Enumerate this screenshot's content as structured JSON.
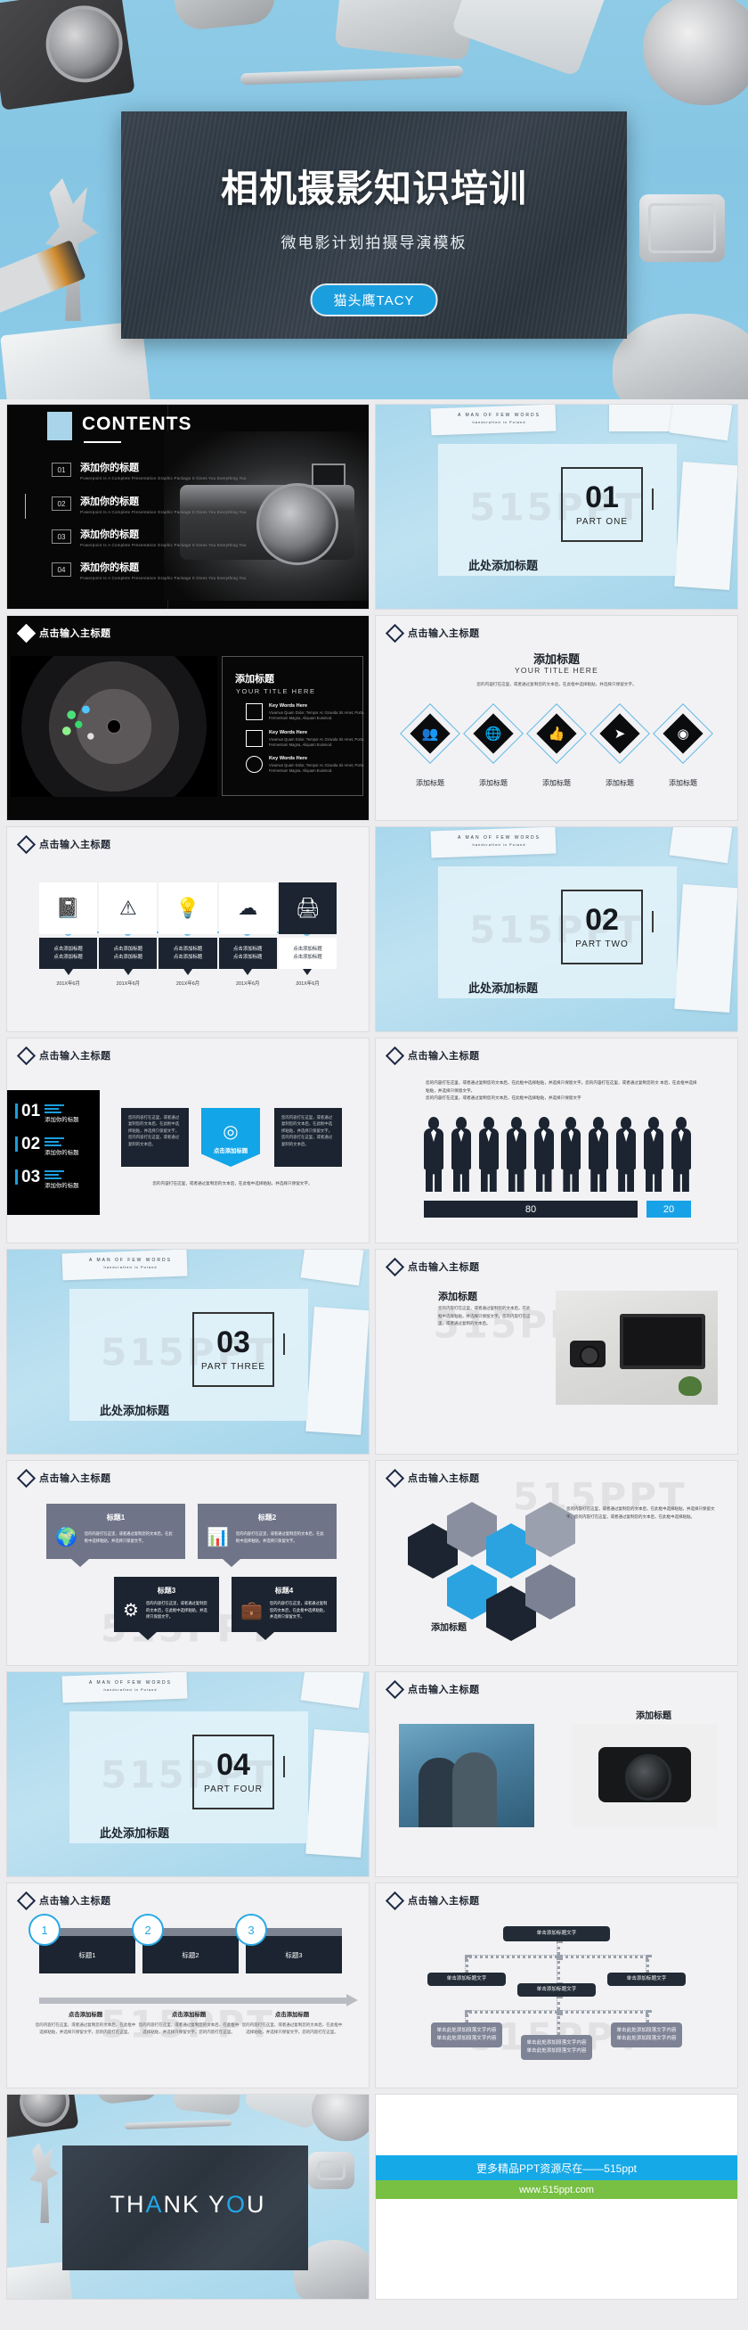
{
  "hero": {
    "title": "相机摄影知识培训",
    "subtitle": "微电影计划拍摄导演模板",
    "button": "猫头鹰TACY"
  },
  "common": {
    "section_header": "点击输入主标题",
    "watermark": "515PPT",
    "add_title": "添加标题",
    "your_title_here": "YOUR TITLE HERE",
    "click_add_title": "点击添加标题",
    "add_your_title": "添加你的标题",
    "lorem_cn": "您的内容打在这里，或者通过复制您的文本后，在此框中选择粘贴，并选择只保留文字。",
    "key_words": "Key Words Here",
    "key_body": "Vivamus Quam Dolor, Tempor Ac Gravida Sit Amet, Porta Fermentum Magna, Aliquam Euismod.",
    "mock_header": "A MAN OF FEW WORDS",
    "mock_sub": "handcrafted in Poland"
  },
  "slides": {
    "contents": {
      "title": "CONTENTS",
      "items": [
        {
          "num": "01",
          "heading": "添加你的标题",
          "desc": "Powerpoint Is A Complete Presentation Graphic Package It Gives You Everything You"
        },
        {
          "num": "02",
          "heading": "添加你的标题",
          "desc": "Powerpoint Is A Complete Presentation Graphic Package It Gives You Everything You"
        },
        {
          "num": "03",
          "heading": "添加你的标题",
          "desc": "Powerpoint Is A Complete Presentation Graphic Package It Gives You Everything You"
        },
        {
          "num": "04",
          "heading": "添加你的标题",
          "desc": "Powerpoint Is A Complete Presentation Graphic Package It Gives You Everything You"
        }
      ]
    },
    "parts": [
      {
        "label": "此处添加标题",
        "num": "01",
        "sub": "PART ONE"
      },
      {
        "label": "此处添加标题",
        "num": "02",
        "sub": "PART TWO"
      },
      {
        "label": "此处添加标题",
        "num": "03",
        "sub": "PART THREE"
      },
      {
        "label": "此处添加标题",
        "num": "04",
        "sub": "PART FOUR"
      }
    ],
    "aperture": {
      "header": "点击输入主标题",
      "panel_title": "添加标题",
      "panel_sub": "YOUR TITLE HERE",
      "keys": [
        {
          "icon": "user-badge-icon",
          "title": "Key Words Here",
          "body": "Vivamus Quam Dolor, Tempor Ac Gravida Sit Amet, Porta Fermentum Magna, Aliquam Euismod."
        },
        {
          "icon": "window-icon",
          "title": "Key Words Here",
          "body": "Vivamus Quam Dolor, Tempor Ac Gravida Sit Amet, Porta Fermentum Magna, Aliquam Euismod."
        },
        {
          "icon": "pie-chart-icon",
          "title": "Key Words Here",
          "body": "Vivamus Quam Dolor, Tempor Ac Gravida Sit Amet, Porta Fermentum Magna, Aliquam Euismod."
        }
      ]
    },
    "diamonds": {
      "header": "点击输入主标题",
      "title": "添加标题",
      "subtitle": "YOUR TITLE HERE",
      "desc": "您的内容打在这里，或者通过复制您的文本后，在此框中选择粘贴，并选择只保留文字。",
      "items": [
        {
          "glyph": "👥",
          "icon": "people-icon",
          "caption": "添加标题"
        },
        {
          "glyph": "🌐",
          "icon": "globe-icon",
          "caption": "添加标题"
        },
        {
          "glyph": "👍",
          "icon": "thumbs-up-icon",
          "caption": "添加标题"
        },
        {
          "glyph": "➤",
          "icon": "paper-plane-icon",
          "caption": "添加标题"
        },
        {
          "glyph": "◉",
          "icon": "eye-icon",
          "caption": "添加标题"
        }
      ]
    },
    "timeline_icons": {
      "header": "点击输入主标题",
      "items": [
        {
          "glyph": "📓",
          "icon": "notebook-icon",
          "line1": "点击添加标题",
          "line2": "点击添加标题",
          "date": "201X年6月"
        },
        {
          "glyph": "⚠",
          "icon": "warning-icon",
          "line1": "点击添加标题",
          "line2": "点击添加标题",
          "date": "201X年6月"
        },
        {
          "glyph": "💡",
          "icon": "lightbulb-icon",
          "line1": "点击添加标题",
          "line2": "点击添加标题",
          "date": "201X年6月"
        },
        {
          "glyph": "☁",
          "icon": "cloud-icon",
          "line1": "点击添加标题",
          "line2": "点击添加标题",
          "date": "201X年6月"
        },
        {
          "glyph": "🖨",
          "icon": "printer-icon",
          "line1": "点击添加标题",
          "line2": "点击添加标题",
          "date": "201X年6月"
        }
      ]
    },
    "numbered": {
      "header": "点击输入主标题",
      "list": [
        {
          "num": "01",
          "label": "添加你的标题"
        },
        {
          "num": "02",
          "label": "添加你的标题"
        },
        {
          "num": "03",
          "label": "添加你的标题"
        }
      ],
      "left_box": "您的内容打在这里，或者通过复制您的文本后，在此框中选择粘贴，并选择只保留文字。您的内容打在这里，或者通过复制的文本后。",
      "right_box": "您的内容打在这里，或者通过复制您的文本后，在此框中选择粘贴，并选择只保留文字。您的内容打在这里，或者通过复制的文本后。",
      "center_caption": "点击添加标题",
      "center_icon": "target-icon",
      "footer": "您的内容打在这里，或者通过复制您的文本后，在此框中选择粘贴，并选择只保留文字。"
    },
    "people": {
      "header": "点击输入主标题",
      "desc_line1": "您的内容打在这里，或者通过复制您的文本后，在此框中选择粘贴，并选择只保留文字。您的内容打在这里，或者通过复制您的文",
      "desc_line2": "本后，在此框中选择粘贴，并选择只保留文字。",
      "desc_line3": "您的内容打在这里，或者通过复制您的文本后，在此框中选择粘贴，并选择只保留文字"
    },
    "laptop": {
      "header": "点击输入主标题",
      "title": "添加标题",
      "body": "您的内容打在这里，或者通过复制您的文本后，在此框中选择粘贴，并选择只保留文字。您的内容打在这里，或者通过复制的文本后。"
    },
    "cards4": {
      "header": "点击输入主标题",
      "items": [
        {
          "title": "标题1",
          "glyph": "🌍",
          "icon": "globe-icon",
          "body": "您的内容打在这里，或者通过复制您的文本后，在此框中选择粘贴，并选择只保留文字。",
          "tone": "gray"
        },
        {
          "title": "标题2",
          "glyph": "📊",
          "icon": "bar-chart-icon",
          "body": "您的内容打在这里，或者通过复制您的文本后，在此框中选择粘贴，并选择只保留文字。",
          "tone": "gray"
        },
        {
          "title": "标题3",
          "glyph": "⚙",
          "icon": "gears-icon",
          "body": "您的内容打在这里，或者通过复制您的文本后，在此框中选择粘贴，并选择只保留文字。",
          "tone": "dark"
        },
        {
          "title": "标题4",
          "glyph": "💼",
          "icon": "briefcase-icon",
          "body": "您的内容打在这里，或者通过复制您的文本后，在此框中选择粘贴，并选择只保留文字。",
          "tone": "dark"
        }
      ]
    },
    "hexagons": {
      "header": "点击输入主标题",
      "caption": "添加标题",
      "body": "您的内容打在这里，或者通过复制您的文本后，在此框中选择粘贴，并选择只保留文字。您的内容打在这里，或者通过复制您的文本后，在此框中选择粘贴。"
    },
    "steps": {
      "header": "点击输入主标题",
      "items": [
        {
          "num": "1",
          "label": "标题1",
          "title": "点击添加标题",
          "body": "您的内容打在这里，或者通过复制您的文本后，在此框中选择粘贴，并选择只保留文字。您的内容打在这里。"
        },
        {
          "num": "2",
          "label": "标题2",
          "title": "点击添加标题",
          "body": "您的内容打在这里，或者通过复制您的文本后，在此框中选择粘贴，并选择只保留文字。您的内容打在这里。"
        },
        {
          "num": "3",
          "label": "标题3",
          "title": "点击添加标题",
          "body": "您的内容打在这里，或者通过复制您的文本后，在此框中选择粘贴，并选择只保留文字。您的内容打在这里。"
        }
      ]
    },
    "couple": {
      "header": "点击输入主标题",
      "title": "添加标题"
    },
    "orgchart": {
      "header": "点击输入主标题",
      "root": "单击添加标题文字",
      "level2": [
        "单击添加标题文字",
        "单击添加标题文字",
        "单击添加标题文字"
      ],
      "level3": [
        "单击此处添加段落文字内容\n单击此处添加段落文字内容",
        "单击此处添加段落文字内容\n单击此处添加段落文字内容",
        "单击此处添加段落文字内容\n单击此处添加段落文字内容"
      ]
    },
    "thankyou": {
      "part1": "TH",
      "accent1": "A",
      "part2": "NK Y",
      "accent2": "O",
      "part3": "U"
    },
    "promo": {
      "line1": "更多精品PPT资源尽在——515ppt",
      "line2": "www.515ppt.com",
      "blue": "#16a9e8",
      "green": "#77c043"
    }
  },
  "chart_data": {
    "type": "bar",
    "title": "点击输入主标题",
    "categories": [
      "80",
      "20"
    ],
    "values": [
      80,
      20
    ],
    "labels": [
      "80",
      "20"
    ],
    "colors": [
      "#1b2430",
      "#17a2e8"
    ],
    "orientation": "horizontal-stacked",
    "icon_count": 10,
    "icon_name": "businessman-silhouette"
  }
}
